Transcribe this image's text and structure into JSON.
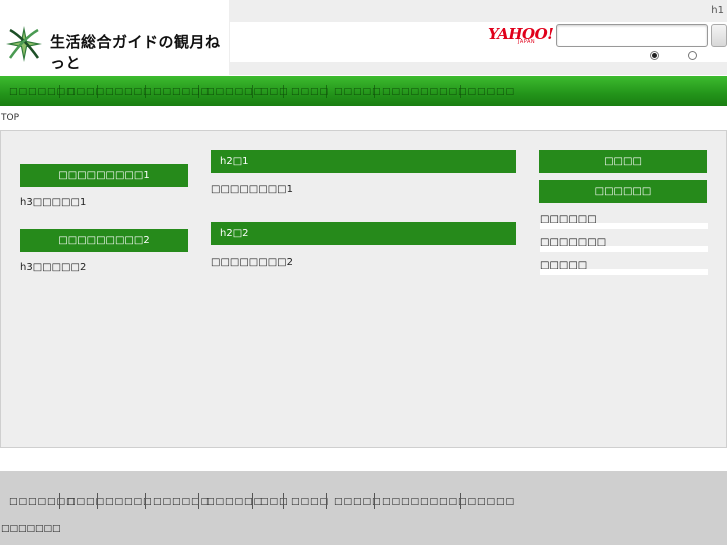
{
  "header": {
    "site_title": "生活総合ガイドの観月ねっと",
    "h1": "h1",
    "search": {
      "brand_main": "YAHOO!",
      "brand_sub": "JAPAN",
      "query": "",
      "placeholder": "",
      "scope_options": [
        "",
        ""
      ],
      "selected_scope": 0
    }
  },
  "global_nav": [
    "□□□□□□□",
    "□□□□",
    "□□□□□",
    "□□□□□□",
    "□□□□□□",
    "□□□",
    "□□□□",
    "□□□□□",
    "□□□□□□□□□□□□□□"
  ],
  "breadcrumb": "TOP",
  "left_column": {
    "sections": [
      {
        "heading": "□□□□□□□□□1",
        "item": "h3□□□□□1"
      },
      {
        "heading": "□□□□□□□□□2",
        "item": "h3□□□□□2"
      }
    ]
  },
  "center_column": {
    "sections": [
      {
        "heading": "h2□1",
        "item": "□□□□□□□□1"
      },
      {
        "heading": "h2□2",
        "item": "□□□□□□□□2"
      }
    ]
  },
  "right_column": {
    "heading_1": "□□□□",
    "heading_2": "□□□□□□",
    "links": [
      "□□□□□□",
      "□□□□□□□",
      "□□□□□"
    ]
  },
  "footer": {
    "nav": [
      "□□□□□□□",
      "□□□□",
      "□□□□□",
      "□□□□□□",
      "□□□□□□",
      "□□□",
      "□□□□",
      "□□□□□",
      "□□□□□□□□□□□□□□"
    ],
    "copyright": "□□□□□□□"
  },
  "colors": {
    "nav_green": "#23941a",
    "heading_green": "#268a1b",
    "yahoo_red": "#e0001b",
    "main_bg": "#eeeeee",
    "footer_bg": "#cfcfcf"
  }
}
